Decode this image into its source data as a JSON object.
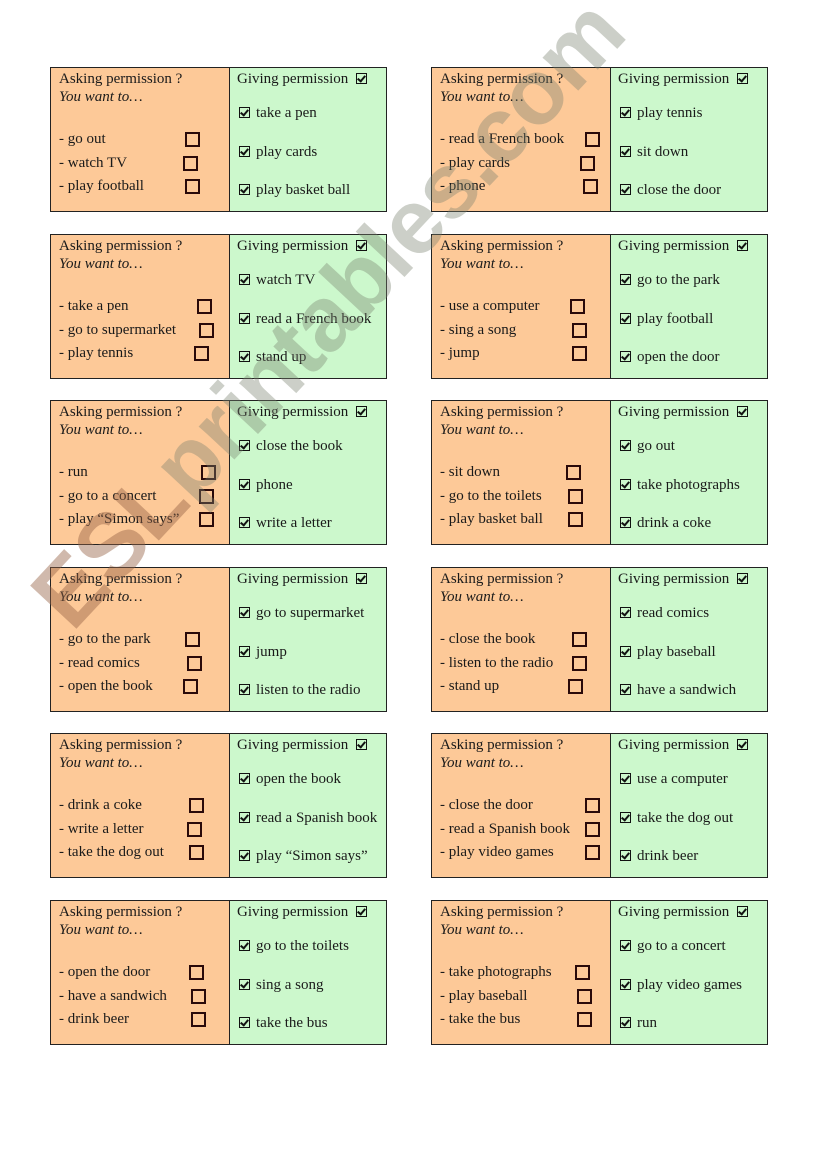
{
  "labels": {
    "ask_title": "Asking permission ?",
    "ask_subtitle": "You want to…",
    "give_title": "Giving permission"
  },
  "colors": {
    "ask_bg": "#fdc998",
    "give_bg": "#ccf8cc",
    "border": "#222222"
  },
  "watermark": {
    "esl": "ESL",
    "rest": "printables.com"
  },
  "cards": [
    {
      "ask": [
        "- go out",
        "- watch TV",
        "- play football"
      ],
      "give": [
        "take a pen",
        "play cards",
        "play basket ball"
      ]
    },
    {
      "ask": [
        "- read a French book",
        "- play cards",
        "- phone"
      ],
      "give": [
        "play tennis",
        "sit down",
        "close the door"
      ]
    },
    {
      "ask": [
        "- take a pen",
        "- go to supermarket",
        "- play tennis"
      ],
      "give": [
        "watch TV",
        "read a French book",
        "stand up"
      ]
    },
    {
      "ask": [
        "- use a computer",
        "- sing a song",
        "- jump"
      ],
      "give": [
        "go to the park",
        "play football",
        "open the door"
      ]
    },
    {
      "ask": [
        "- run",
        "- go to a concert",
        "- play “Simon says”"
      ],
      "give": [
        "close the book",
        "phone",
        "write a letter"
      ]
    },
    {
      "ask": [
        "- sit down",
        "- go to the toilets",
        "- play basket ball"
      ],
      "give": [
        "go out",
        "take photographs",
        "drink a coke"
      ]
    },
    {
      "ask": [
        "- go to the park",
        "- read comics",
        "- open the book"
      ],
      "give": [
        "go to supermarket",
        "jump",
        "listen to the radio"
      ]
    },
    {
      "ask": [
        "- close the book",
        "- listen to the radio",
        "- stand up"
      ],
      "give": [
        "read comics",
        "play baseball",
        "have a sandwich"
      ]
    },
    {
      "ask": [
        "- drink a coke",
        "- write a letter",
        "- take the dog out"
      ],
      "give": [
        "open the book",
        "read a Spanish book",
        "play “Simon says”"
      ]
    },
    {
      "ask": [
        "- close the door",
        "- read a Spanish book",
        "- play video games"
      ],
      "give": [
        "use a computer",
        "take the dog out",
        "drink beer"
      ]
    },
    {
      "ask": [
        "- open the door",
        "- have a sandwich",
        "- drink beer"
      ],
      "give": [
        "go to the toilets",
        "sing a song",
        "take the bus"
      ]
    },
    {
      "ask": [
        "- take photographs",
        "- play baseball",
        "- take the bus"
      ],
      "give": [
        "go to a concert",
        "play video games",
        "run"
      ]
    }
  ]
}
